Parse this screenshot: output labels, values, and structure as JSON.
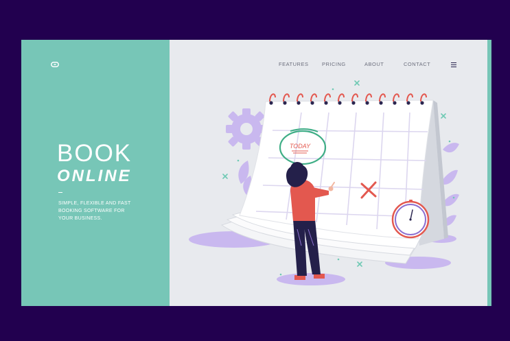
{
  "hero": {
    "title_line1": "BOOK",
    "title_line2": "ONLINE",
    "tagline_line1": "SIMPLE, FLEXIBLE AND FAST",
    "tagline_line2": "BOOKING SOFTWARE FOR",
    "tagline_line3": "YOUR BUSINESS."
  },
  "nav": {
    "features": "FEATURES",
    "pricing": "PRICING",
    "about": "ABOUT",
    "contact": "CONTACT"
  },
  "calendar": {
    "today_label": "TODAY"
  },
  "icons": {
    "logo": "link-logo-icon",
    "menu": "hamburger-menu-icon"
  },
  "colors": {
    "background": "#22004f",
    "accent_teal": "#77c6b7",
    "page": "#e8eaee",
    "coral": "#e3584f",
    "lavender": "#c9b8ef",
    "navy": "#24204a"
  }
}
